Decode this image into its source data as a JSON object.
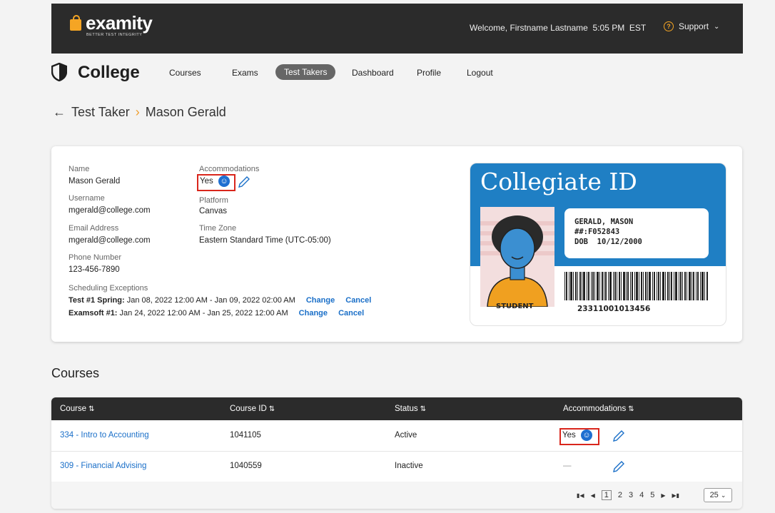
{
  "header": {
    "logo_text": "examity",
    "logo_tagline": "BETTER TEST INTEGRITY",
    "welcome": "Welcome, Firstname Lastname",
    "time": "5:05 PM",
    "timezone": "EST",
    "support_label": "Support"
  },
  "nav": {
    "brand": "College",
    "items": [
      {
        "label": "Courses"
      },
      {
        "label": "Exams"
      },
      {
        "label": "Test Takers",
        "active": true
      },
      {
        "label": "Dashboard"
      },
      {
        "label": "Profile"
      },
      {
        "label": "Logout"
      }
    ]
  },
  "breadcrumb": {
    "parent": "Test Taker",
    "current": "Mason Gerald"
  },
  "profile": {
    "name_label": "Name",
    "name": "Mason Gerald",
    "username_label": "Username",
    "username": "mgerald@college.com",
    "email_label": "Email Address",
    "email": "mgerald@college.com",
    "phone_label": "Phone Number",
    "phone": "123-456-7890",
    "accommodations_label": "Accommodations",
    "accommodations": "Yes",
    "platform_label": "Platform",
    "platform": "Canvas",
    "timezone_label": "Time Zone",
    "timezone": "Eastern Standard Time (UTC-05:00)",
    "exceptions_label": "Scheduling Exceptions",
    "exceptions": [
      {
        "exam": "Test #1 Spring:",
        "range": "Jan 08, 2022 12:00 AM - Jan 09, 2022 02:00 AM",
        "change": "Change",
        "cancel": "Cancel"
      },
      {
        "exam": "Examsoft #1:",
        "range": "Jan 24, 2022 12:00 AM - Jan 25, 2022 12:00 AM",
        "change": "Change",
        "cancel": "Cancel"
      }
    ]
  },
  "id_card": {
    "title": "Collegiate ID",
    "name": "GERALD, MASON",
    "number": "##:F052843",
    "dob_label": "DOB",
    "dob": "10/12/2000",
    "role": "STUDENT",
    "barcode_number": "23311001013456"
  },
  "courses": {
    "title": "Courses",
    "columns": [
      "Course",
      "Course ID",
      "Status",
      "Accommodations"
    ],
    "rows": [
      {
        "course": "334 - Intro to Accounting",
        "id": "1041105",
        "status": "Active",
        "accommodations": "Yes"
      },
      {
        "course": "309 - Financial Advising",
        "id": "1040559",
        "status": "Inactive",
        "accommodations": "—"
      }
    ],
    "pages": [
      "1",
      "2",
      "3",
      "4",
      "5"
    ],
    "current_page": "1",
    "per_page": "25"
  },
  "colors": {
    "accent": "#1a6fc8",
    "highlight": "#d9261c",
    "topbar": "#2b2b2b",
    "id_blue": "#1f7fc4"
  }
}
